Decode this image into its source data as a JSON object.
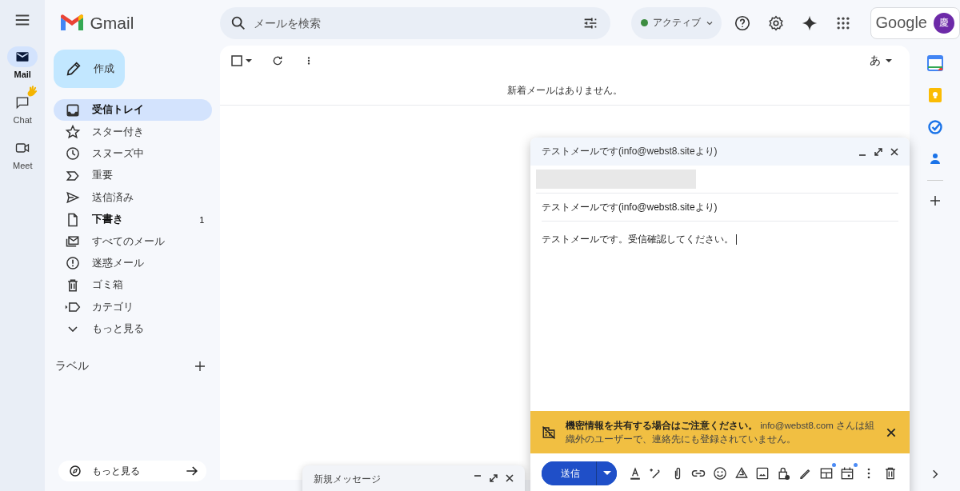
{
  "header": {
    "brand": "Gmail",
    "search": {
      "placeholder": "メールを検索"
    },
    "status": {
      "label": "アクティブ",
      "color": "#3c8c40"
    },
    "account": {
      "brand": "Google",
      "avatar": "慶"
    }
  },
  "rail": [
    {
      "label": "Mail",
      "selected": true
    },
    {
      "label": "Chat",
      "selected": false
    },
    {
      "label": "Meet",
      "selected": false
    }
  ],
  "compose_button": "作成",
  "folders": [
    {
      "kind": "inbox",
      "label": "受信トレイ",
      "selected": true,
      "unread": true
    },
    {
      "kind": "star",
      "label": "スター付き",
      "selected": false,
      "unread": false
    },
    {
      "kind": "clock",
      "label": "スヌーズ中",
      "selected": false,
      "unread": false
    },
    {
      "kind": "important",
      "label": "重要",
      "selected": false,
      "unread": false
    },
    {
      "kind": "sent",
      "label": "送信済み",
      "selected": false,
      "unread": false
    },
    {
      "kind": "draft",
      "label": "下書き",
      "selected": false,
      "unread": true,
      "count": "1"
    },
    {
      "kind": "all",
      "label": "すべてのメール",
      "selected": false,
      "unread": false
    },
    {
      "kind": "spam",
      "label": "迷惑メール",
      "selected": false,
      "unread": false
    },
    {
      "kind": "trash",
      "label": "ゴミ箱",
      "selected": false,
      "unread": false
    },
    {
      "kind": "category",
      "label": "カテゴリ",
      "selected": false,
      "unread": false
    },
    {
      "kind": "more",
      "label": "もっと見る",
      "selected": false,
      "unread": false
    }
  ],
  "labels_heading": "ラベル",
  "bottom_button": "もっと見る",
  "toolbar": {
    "select_all": {
      "checked": false
    },
    "input_tool": "あ"
  },
  "empty_message": "新着メールはありません。",
  "compose": {
    "title": "テストメールです(info@webst8.siteより)",
    "subject": "テストメールです(info@webst8.siteより)",
    "body": "テストメールです。受信確認してください。",
    "warning": "**機密情報を共有する場合はご注意ください。** info@webst8.com さんは組織外のユーザーで、連絡先にも登録されていません。",
    "send": "送信"
  },
  "minimized_compose": {
    "title": "新規メッセージ"
  }
}
